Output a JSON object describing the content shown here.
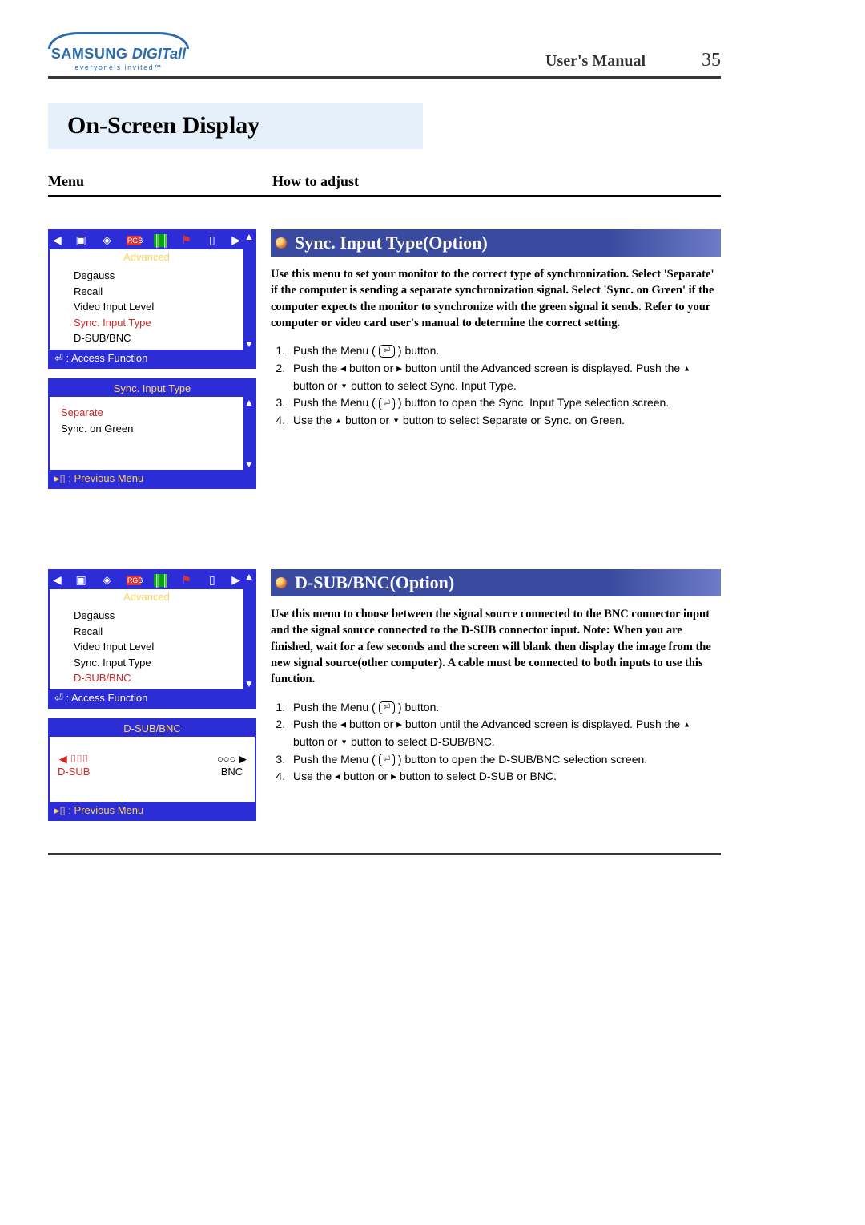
{
  "header": {
    "logo_main": "SAMSUNG DIGITall",
    "logo_tag": "everyone's invited™",
    "manual": "User's Manual",
    "page": "35"
  },
  "page_title": "On-Screen Display",
  "col_heads": {
    "menu": "Menu",
    "how": "How to adjust"
  },
  "section1": {
    "title": "Sync. Input Type(Option)",
    "desc": "Use this menu to set your monitor to the correct type of synchronization. Select 'Separate' if the computer is sending a separate synchronization signal. Select 'Sync. on Green' if the computer expects the monitor to synchronize with the green signal it sends. Refer to your computer or video card user's manual to determine the correct setting.",
    "steps": [
      "Push the Menu ( ⏎ ) button.",
      "Push the ◂ button or ▸ button until the Advanced screen is displayed. Push the ▴ button or ▾ button to select Sync. Input Type.",
      "Push the Menu ( ⏎ ) button to open the Sync. Input Type selection screen.",
      "Use the ▴ button or ▾ button to select Separate or Sync. on Green."
    ],
    "osd_top_label": "Advanced",
    "osd_items": [
      "Degauss",
      "Recall",
      "Video Input Level",
      "Sync. Input Type",
      "D-SUB/BNC"
    ],
    "osd_highlight_index": 3,
    "osd_access": "⏎ : Access Function",
    "osd_sub_title": "Sync. Input Type",
    "osd_sub_items": [
      "Separate",
      "Sync. on Green"
    ],
    "osd_sub_highlight_index": 0,
    "osd_prev": "▸▯ : Previous Menu"
  },
  "section2": {
    "title": "D-SUB/BNC(Option)",
    "desc": "Use this menu to choose between the signal source connected to the BNC connector input and the signal source connected to the D-SUB connector input. Note: When you are finished, wait for a few seconds and the screen will blank then display the image from the new signal source(other computer). A cable must be connected to both inputs to use this function.",
    "steps": [
      "Push the Menu ( ⏎ ) button.",
      "Push the ◂ button or ▸ button until the Advanced screen is displayed. Push the ▴ button or ▾ button to select D-SUB/BNC.",
      "Push the Menu ( ⏎ ) button to open the D-SUB/BNC selection screen.",
      "Use the ◂ button or ▸ button to select D-SUB or BNC."
    ],
    "osd_top_label": "Advanced",
    "osd_items": [
      "Degauss",
      "Recall",
      "Video Input Level",
      "Sync. Input Type",
      "D-SUB/BNC"
    ],
    "osd_highlight_index": 4,
    "osd_access": "⏎ : Access Function",
    "osd_sub_title": "D-SUB/BNC",
    "osd_sub_left": "D-SUB",
    "osd_sub_right": "BNC",
    "osd_prev": "▸▯ : Previous Menu"
  }
}
